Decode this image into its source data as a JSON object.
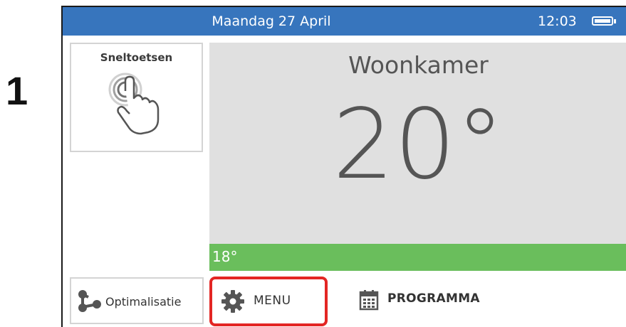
{
  "step": {
    "number": "1"
  },
  "status_bar": {
    "date": "Maandag 27 April",
    "time": "12:03",
    "battery_icon": "battery-full-icon",
    "color": "#3775bd"
  },
  "shortcuts": {
    "label": "Sneltoetsen",
    "icon": "touch-hand-icon"
  },
  "room": {
    "name": "Woonkamer",
    "temperature": "20°",
    "panel_color": "#e0e0e0"
  },
  "setpoint_bar": {
    "value": "18°",
    "color": "#6abe5c"
  },
  "bottom_nav": {
    "optimization": {
      "label": "Optimalisatie",
      "icon": "optimization-nodes-icon"
    },
    "menu": {
      "label": "MENU",
      "icon": "gear-icon",
      "highlight_color": "#e32624"
    },
    "program": {
      "label": "PROGRAMMA",
      "icon": "calendar-icon"
    }
  }
}
